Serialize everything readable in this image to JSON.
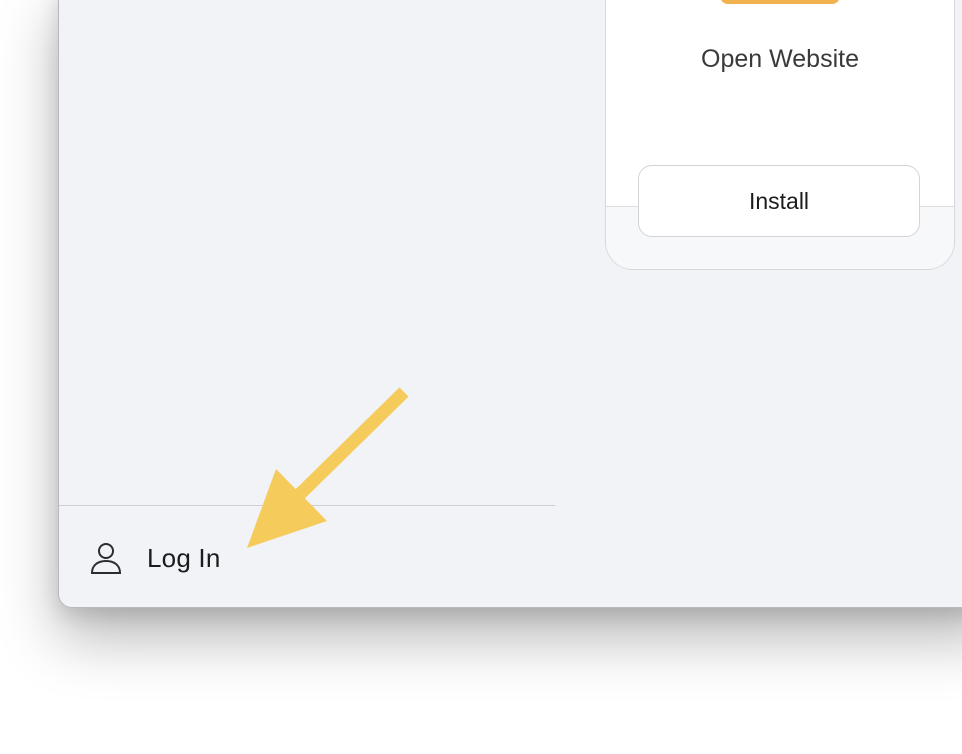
{
  "card": {
    "title": "Open Website",
    "install_label": "Install",
    "accent_color": "#f0b14e"
  },
  "sidebar": {
    "login_label": "Log In",
    "login_icon": "user-icon"
  },
  "annotation": {
    "arrow_color": "#f5cb5c"
  }
}
